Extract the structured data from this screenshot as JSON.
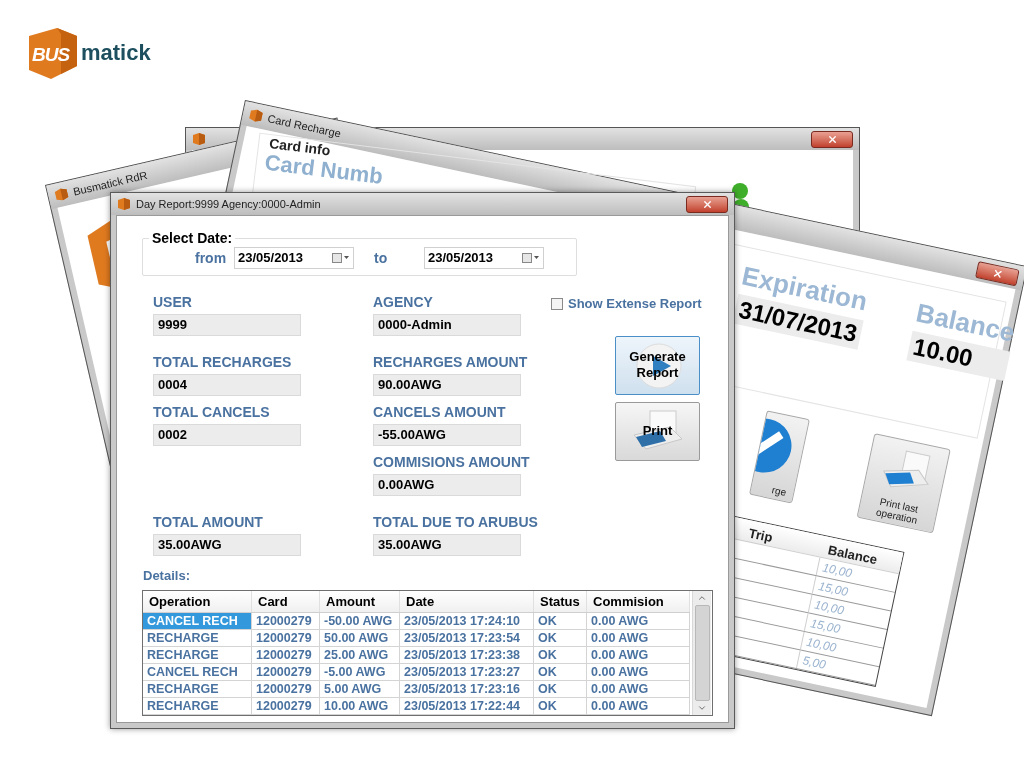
{
  "logo": {
    "mark": "BUS",
    "text": "matick"
  },
  "rdr_window": {
    "title": "Busmatick RdR"
  },
  "recharge_window": {
    "title": "Card Recharge",
    "card_info": {
      "legend": "Card info",
      "label": "Card Numb"
    },
    "expiration": {
      "label": "Expiration",
      "value": "31/07/2013"
    },
    "balance": {
      "label": "Balance",
      "value": "10.00"
    },
    "buttons": [
      {
        "kind": "recharge",
        "label": "rge"
      },
      {
        "kind": "print",
        "label": "Print last operation"
      }
    ],
    "table": {
      "columns": [
        "Trip",
        "Balance"
      ],
      "rows": [
        {
          "balance": "10,00"
        },
        {
          "balance": "15,00"
        },
        {
          "balance": "10,00"
        },
        {
          "balance": "15,00"
        },
        {
          "balance": "10,00"
        },
        {
          "balance": "5,00"
        }
      ]
    }
  },
  "day_report": {
    "title": "Day Report:9999 Agency:0000-Admin",
    "select_date": {
      "legend": "Select Date:",
      "from_label": "from",
      "from": "23/05/2013",
      "to_label": "to",
      "to": "23/05/2013"
    },
    "left_fields": [
      {
        "label": "USER",
        "value": "9999"
      },
      {
        "label": "TOTAL RECHARGES",
        "value": "0004"
      },
      {
        "label": "TOTAL CANCELS",
        "value": "0002"
      }
    ],
    "right_fields": [
      {
        "label": "AGENCY",
        "value": "0000-Admin"
      },
      {
        "label": "RECHARGES AMOUNT",
        "value": "90.00AWG"
      },
      {
        "label": "CANCELS AMOUNT",
        "value": "-55.00AWG"
      },
      {
        "label": "COMMISIONS AMOUNT",
        "value": "0.00AWG"
      }
    ],
    "totals": [
      {
        "label": "TOTAL AMOUNT",
        "value": "35.00AWG"
      },
      {
        "label": "TOTAL DUE TO ARUBUS",
        "value": "35.00AWG"
      }
    ],
    "show_extense": {
      "label": "Show Extense Report",
      "checked": false
    },
    "buttons": [
      {
        "kind": "generate",
        "label": "Generate Report"
      },
      {
        "kind": "print",
        "label": "Print"
      }
    ],
    "details_label": "Details:",
    "table": {
      "columns": [
        "Operation",
        "Card",
        "Amount",
        "Date",
        "Status",
        "Commision"
      ],
      "rows": [
        {
          "selected": true,
          "cells": [
            "CANCEL RECH",
            "12000279",
            "-50.00 AWG",
            "23/05/2013 17:24:10",
            "OK",
            "0.00 AWG"
          ]
        },
        {
          "selected": false,
          "cells": [
            "RECHARGE",
            "12000279",
            "50.00 AWG",
            "23/05/2013 17:23:54",
            "OK",
            "0.00 AWG"
          ]
        },
        {
          "selected": false,
          "cells": [
            "RECHARGE",
            "12000279",
            "25.00 AWG",
            "23/05/2013 17:23:38",
            "OK",
            "0.00 AWG"
          ]
        },
        {
          "selected": false,
          "cells": [
            "CANCEL RECH",
            "12000279",
            "-5.00 AWG",
            "23/05/2013 17:23:27",
            "OK",
            "0.00 AWG"
          ]
        },
        {
          "selected": false,
          "cells": [
            "RECHARGE",
            "12000279",
            "5.00 AWG",
            "23/05/2013 17:23:16",
            "OK",
            "0.00 AWG"
          ]
        },
        {
          "selected": false,
          "cells": [
            "RECHARGE",
            "12000279",
            "10.00 AWG",
            "23/05/2013 17:22:44",
            "OK",
            "0.00 AWG"
          ]
        }
      ]
    }
  }
}
